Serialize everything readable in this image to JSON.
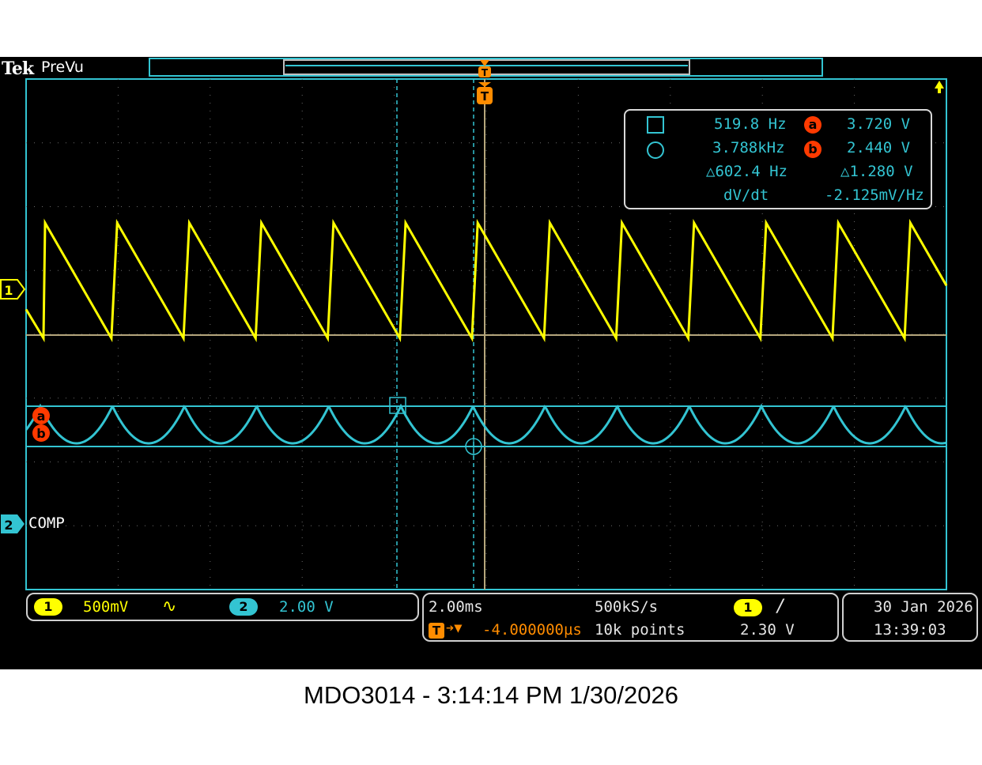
{
  "header": {
    "brand": "Tek",
    "mode": "PreVu"
  },
  "colors": {
    "ch1": "#ffff00",
    "ch2": "#33c4d2",
    "cursor": "#33c4d2",
    "marker": "#ff3a00",
    "trigger": "#ff8c00",
    "grid": "#7a7a7a"
  },
  "channel_markers": {
    "ch1": "1",
    "ch2": "2",
    "ch2_label": "COMP",
    "cursor_a": "a",
    "cursor_b": "b",
    "trigger": "T"
  },
  "cursor_readout": {
    "vbar1_freq": "519.8 Hz",
    "vbar2_freq": "3.788kHz",
    "delta_freq": "△602.4 Hz",
    "slope_label": "dV/dt",
    "a_value": "3.720 V",
    "b_value": "2.440 V",
    "delta_v": "△1.280 V",
    "slope_value": "-2.125mV/Hz",
    "icons": [
      "square-cursor-icon",
      "circle-cursor-icon"
    ]
  },
  "vertical": {
    "ch1_num": "1",
    "ch1_scale": "500mV",
    "ch1_coupling_icon": "ac-coupling-icon",
    "ch1_coupling_glyph": "∿",
    "ch2_num": "2",
    "ch2_scale": "2.00 V"
  },
  "horizontal": {
    "timebase": "2.00ms",
    "delay": "-4.000000µs",
    "sample_rate": "500kS/s",
    "record_length": "10k points"
  },
  "trigger": {
    "source": "1",
    "slope_icon": "rising-edge-icon",
    "slope_glyph": "/",
    "level": "2.30 V"
  },
  "datetime": {
    "date": "30 Jan  2026",
    "time": "13:39:03"
  },
  "caption": "MDO3014 - 3:14:14 PM    1/30/2026",
  "chart_data": {
    "type": "line",
    "xlabel": "",
    "ylabel": "",
    "grid": true,
    "series": [
      {
        "channel": "1",
        "shape": "sawtooth",
        "volts_per_div": 0.5
      },
      {
        "channel": "2",
        "shape": "scalloped",
        "volts_per_div": 2.0
      }
    ],
    "cursors": {
      "a_volts": 3.72,
      "b_volts": 2.44,
      "f1_hz": 519.8,
      "f2_hz": 3788
    }
  }
}
